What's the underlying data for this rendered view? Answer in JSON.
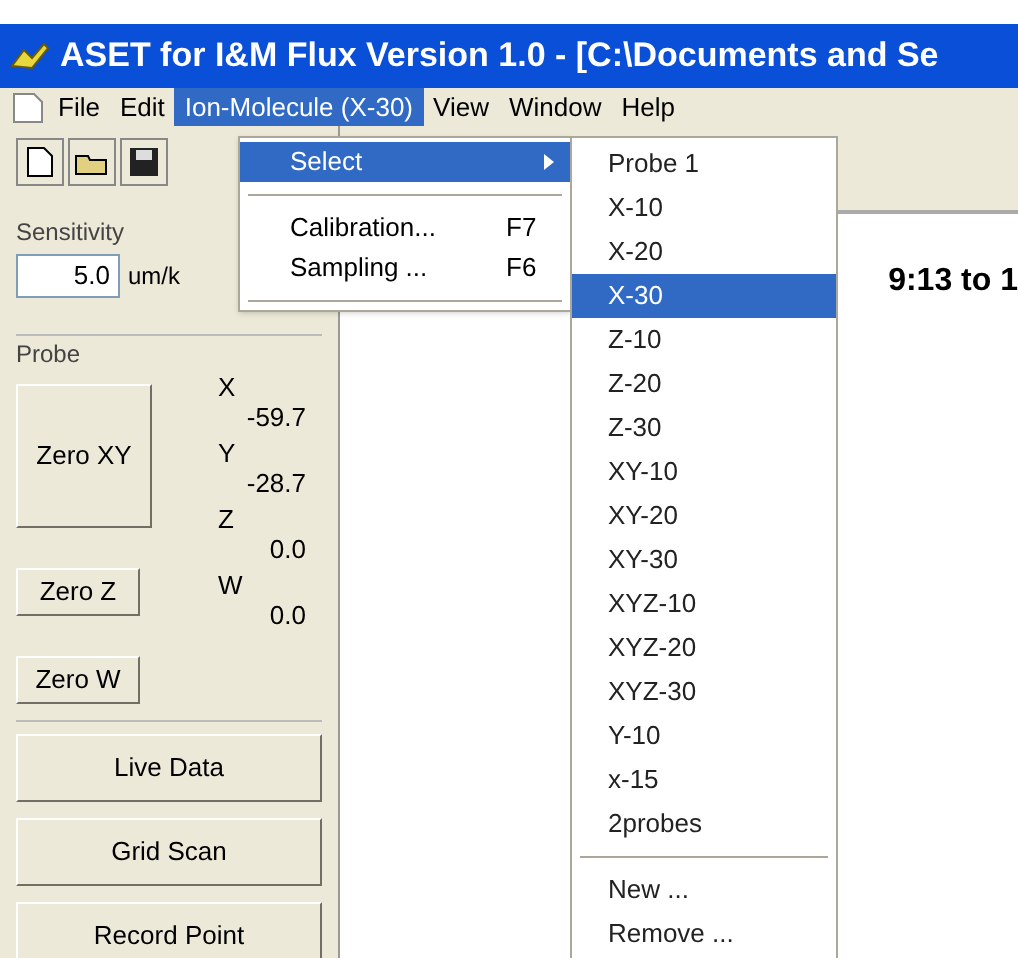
{
  "window": {
    "title": "ASET for I&M Flux Version 1.0 - [C:\\Documents and Se"
  },
  "menu_bar": [
    {
      "label": "File",
      "selected": false
    },
    {
      "label": "Edit",
      "selected": false
    },
    {
      "label": "Ion-Molecule (X-30)",
      "selected": true
    },
    {
      "label": "View",
      "selected": false
    },
    {
      "label": "Window",
      "selected": false
    },
    {
      "label": "Help",
      "selected": false
    }
  ],
  "menu": [
    {
      "label": "Select",
      "submenu": true,
      "selected": true
    },
    {
      "label": "Calibration...",
      "shortcut": "F7",
      "submenu": false,
      "selected": false
    },
    {
      "label": "Sampling ...",
      "shortcut": "F6",
      "submenu": false,
      "selected": false
    }
  ],
  "submenu": {
    "items": [
      {
        "label": "Probe 1",
        "selected": false
      },
      {
        "label": "X-10",
        "selected": false
      },
      {
        "label": "X-20",
        "selected": false
      },
      {
        "label": "X-30",
        "selected": true
      },
      {
        "label": "Z-10",
        "selected": false
      },
      {
        "label": "Z-20",
        "selected": false
      },
      {
        "label": "Z-30",
        "selected": false
      },
      {
        "label": "XY-10",
        "selected": false
      },
      {
        "label": "XY-20",
        "selected": false
      },
      {
        "label": "XY-30",
        "selected": false
      },
      {
        "label": "XYZ-10",
        "selected": false
      },
      {
        "label": "XYZ-20",
        "selected": false
      },
      {
        "label": "XYZ-30",
        "selected": false
      },
      {
        "label": "Y-10",
        "selected": false
      },
      {
        "label": "x-15",
        "selected": false
      },
      {
        "label": "2probes",
        "selected": false
      }
    ],
    "actions": [
      "New ...",
      "Remove ..."
    ]
  },
  "sensitivity": {
    "label": "Sensitivity",
    "value": "5.0",
    "unit": "um/k"
  },
  "probe": {
    "label": "Probe",
    "zero_xy": "Zero XY",
    "zero_z": "Zero Z",
    "zero_w": "Zero W",
    "readings": [
      {
        "axis": "X",
        "value": "-59.7"
      },
      {
        "axis": "Y",
        "value": "-28.7"
      },
      {
        "axis": "Z",
        "value": "0.0"
      },
      {
        "axis": "W",
        "value": "0.0"
      }
    ]
  },
  "buttons": [
    "Live Data",
    "Grid Scan",
    "Record Point"
  ],
  "time_range": "9:13 to 1"
}
